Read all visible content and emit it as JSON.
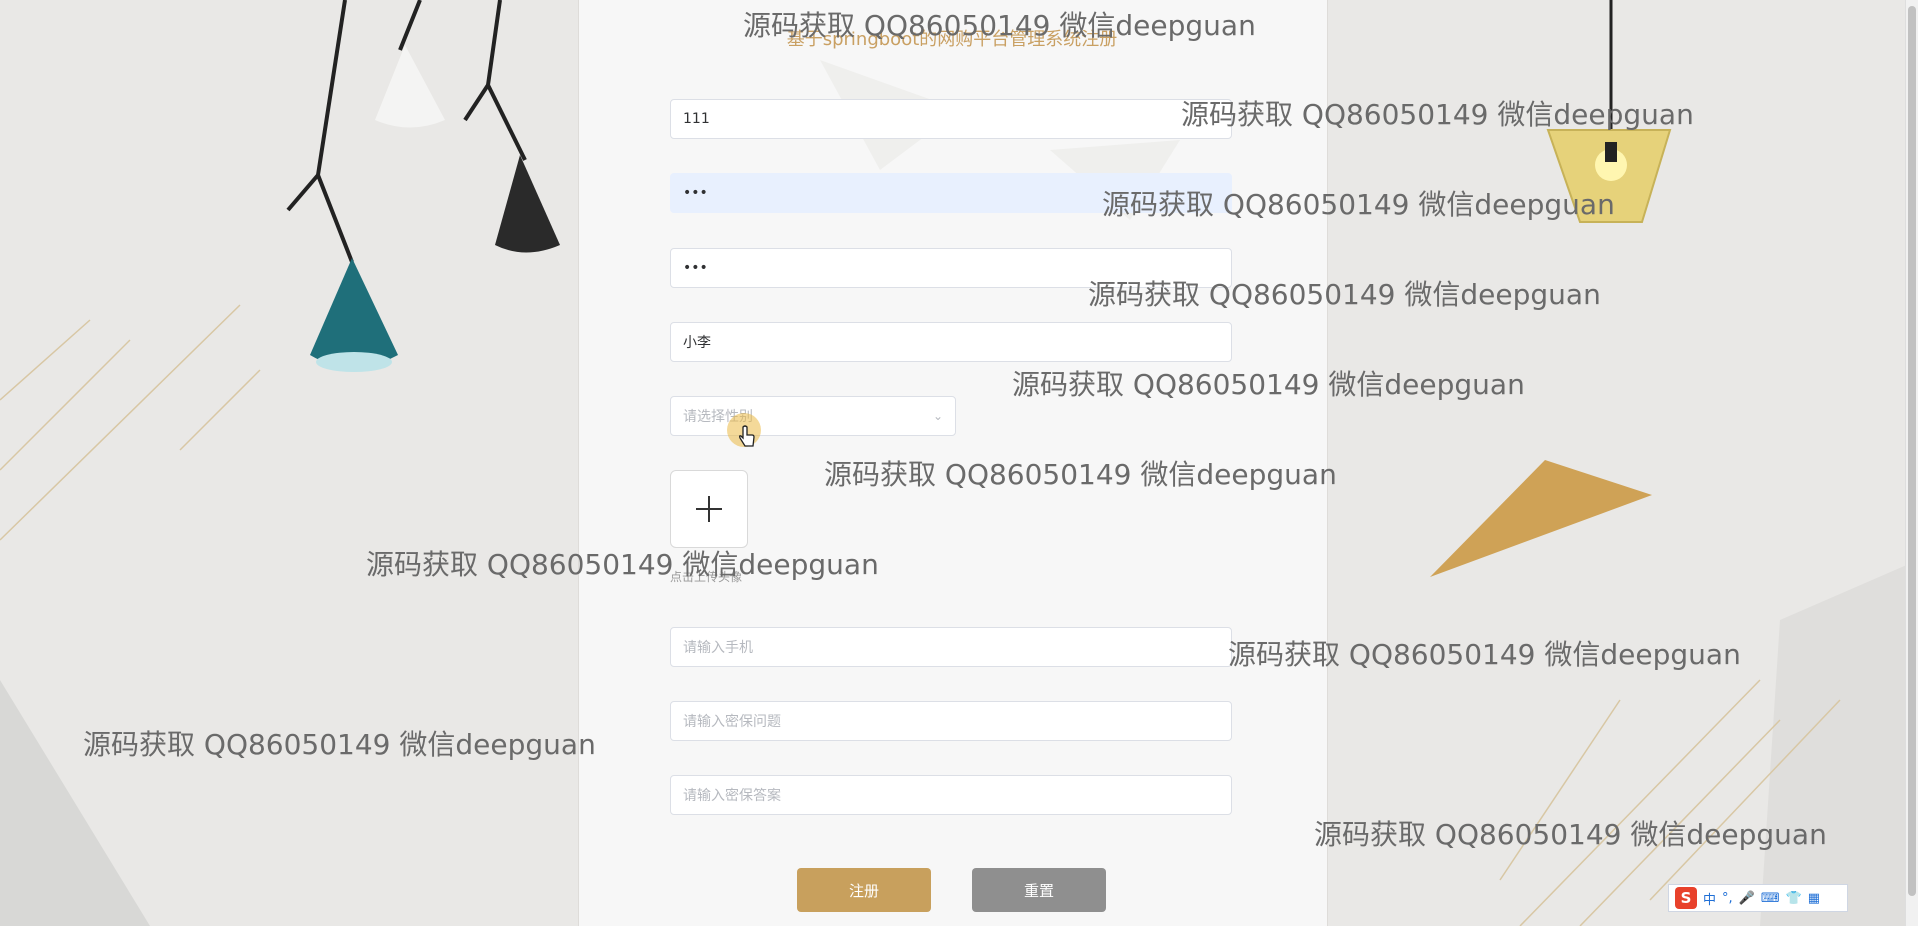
{
  "page": {
    "title": "基于springboot的网购平台管理系统注册"
  },
  "form": {
    "account_value": "111",
    "password_value": "•••",
    "confirm_password_value": "•••",
    "name_value": "小李",
    "gender_placeholder": "请选择性别",
    "upload_hint": "点击上传头像",
    "phone_placeholder": "请输入手机",
    "security_question_placeholder": "请输入密保问题",
    "security_answer_placeholder": "请输入密保答案"
  },
  "buttons": {
    "register": "注册",
    "reset": "重置"
  },
  "watermark": "源码获取 QQ86050149 微信deepguan",
  "ime": {
    "mode": "中",
    "punct": "°,"
  },
  "icons": [
    "plus-icon",
    "chevron-down-icon",
    "hand-cursor-icon",
    "microphone-icon",
    "keyboard-icon",
    "shirt-icon",
    "grid-icon"
  ],
  "colors": {
    "accent": "#c8a05d",
    "reset": "#8f8f8f",
    "title": "#c9a063",
    "autofill": "#e8f0fe"
  }
}
